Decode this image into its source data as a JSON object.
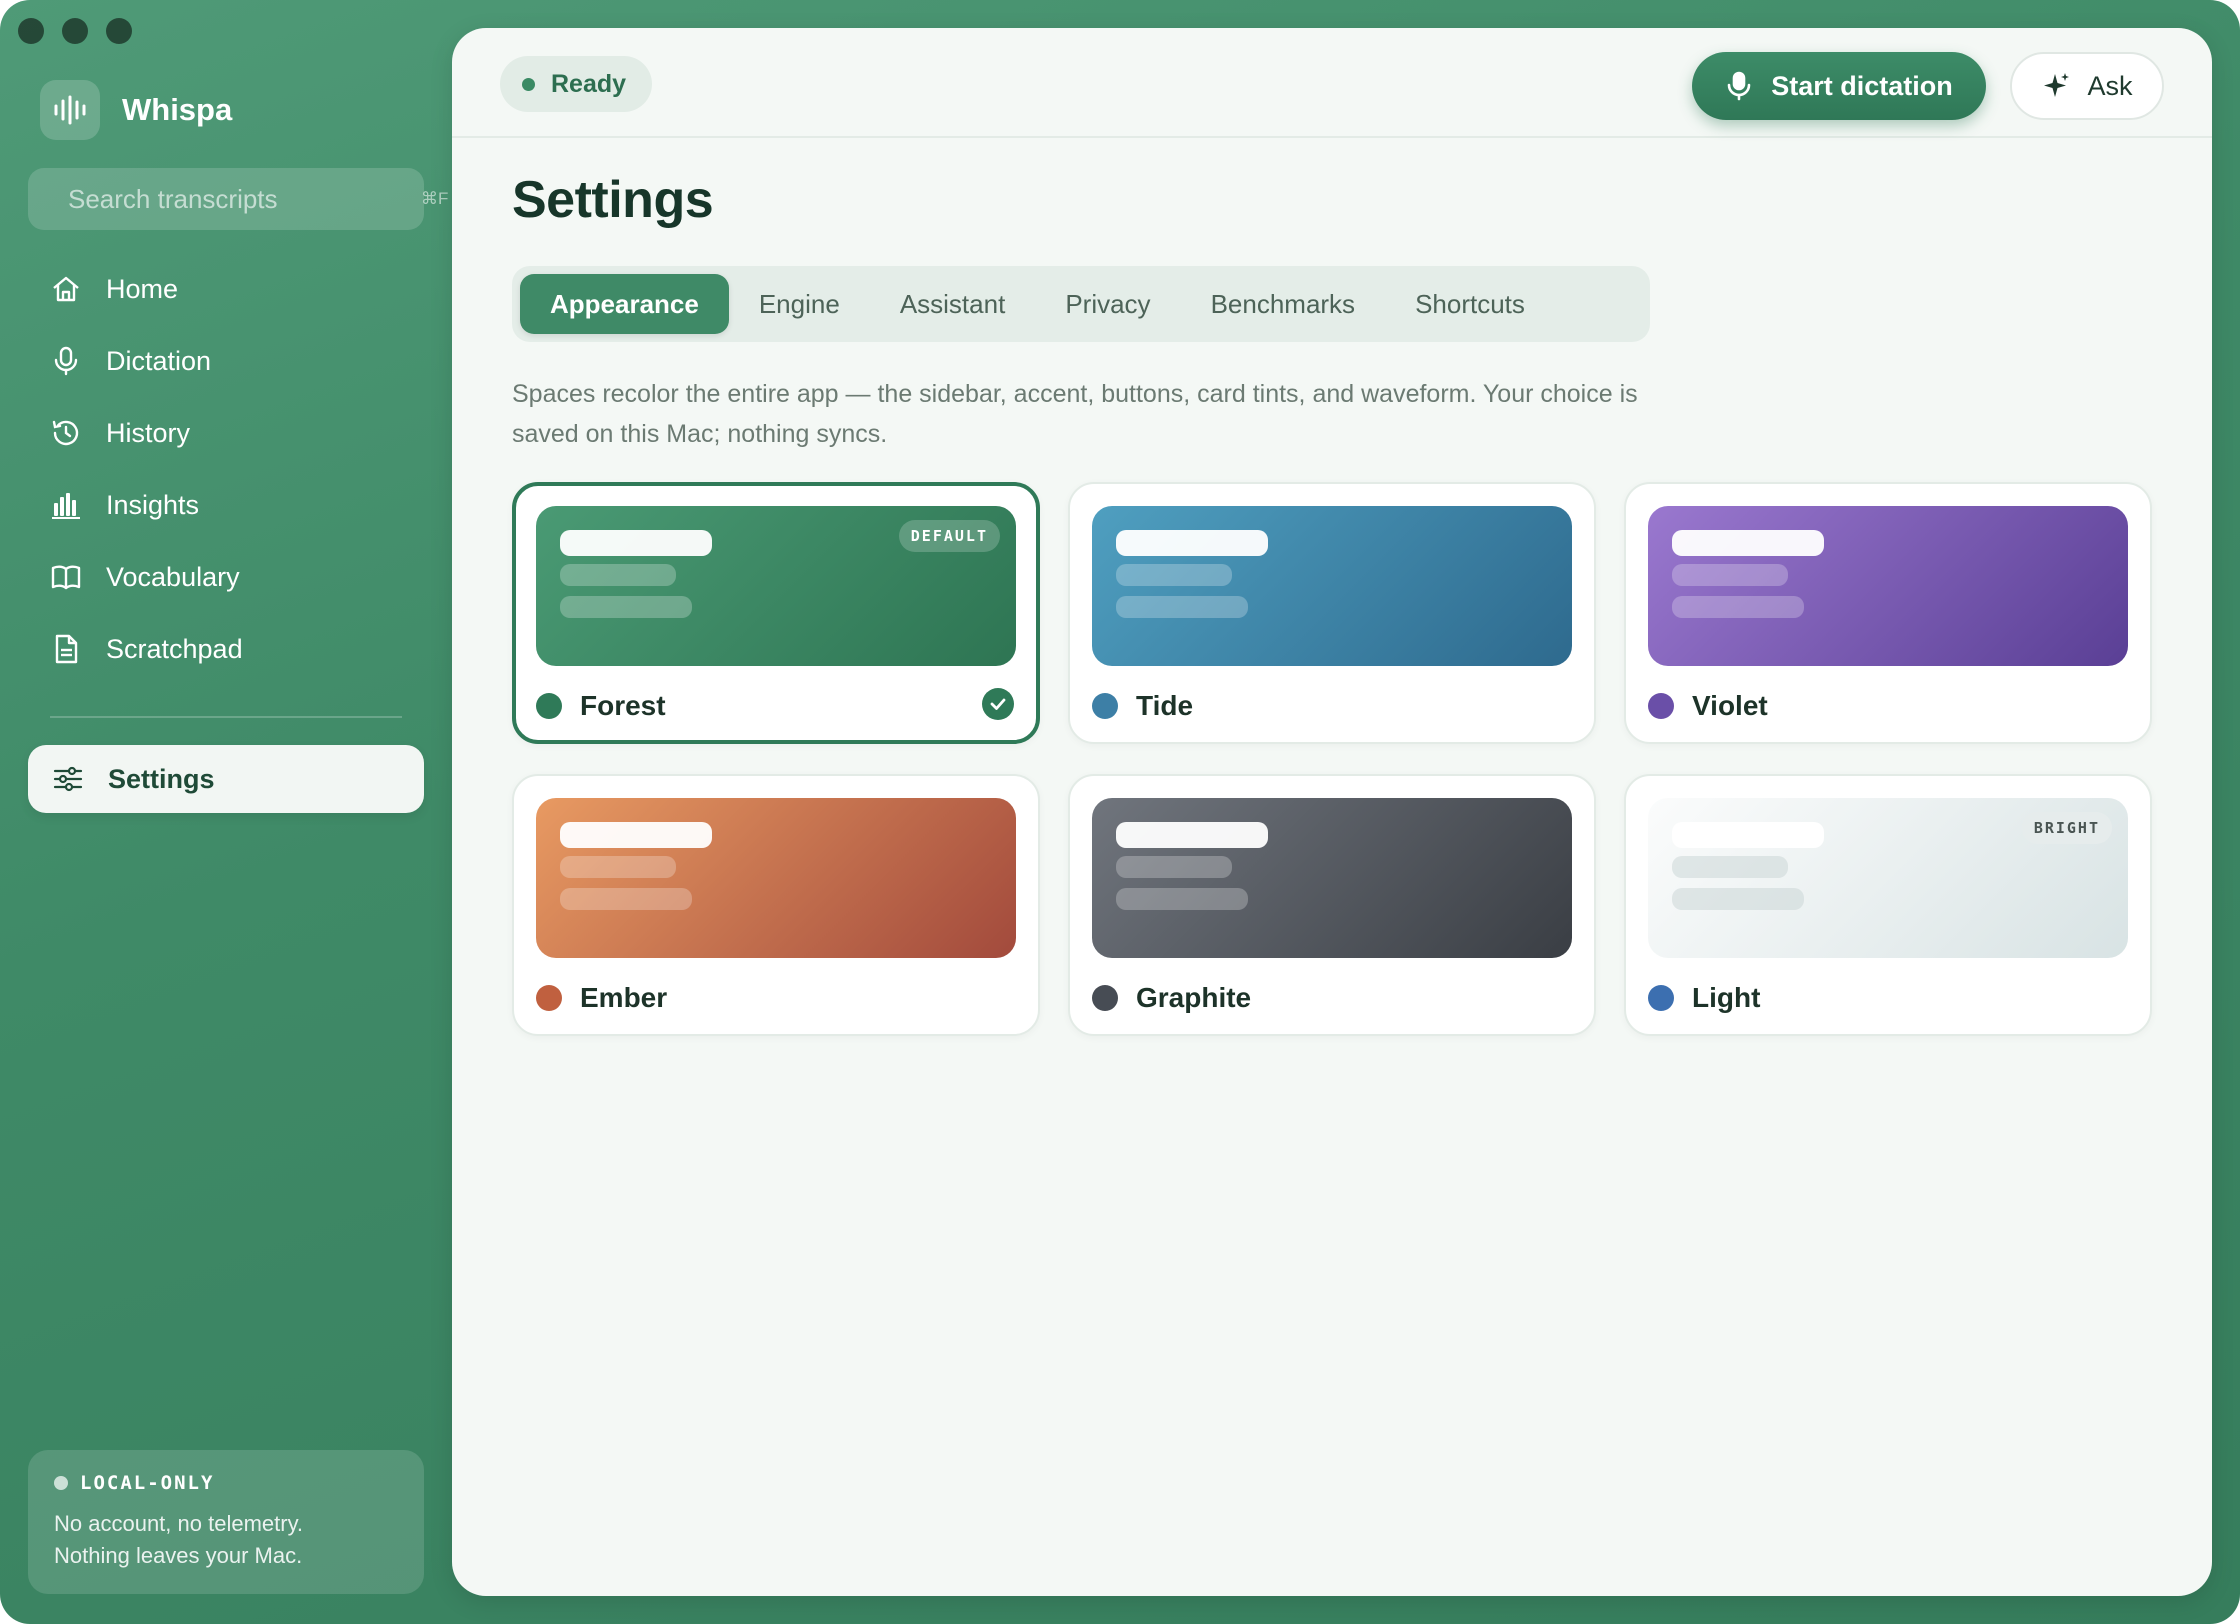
{
  "app": {
    "name": "Whispa"
  },
  "search": {
    "placeholder": "Search transcripts",
    "shortcut": "⌘F"
  },
  "nav": {
    "items": [
      {
        "label": "Home",
        "icon": "home-icon"
      },
      {
        "label": "Dictation",
        "icon": "microphone-icon"
      },
      {
        "label": "History",
        "icon": "history-icon"
      },
      {
        "label": "Insights",
        "icon": "bar-chart-icon"
      },
      {
        "label": "Vocabulary",
        "icon": "book-icon"
      },
      {
        "label": "Scratchpad",
        "icon": "document-icon"
      }
    ],
    "settings_label": "Settings"
  },
  "local": {
    "title": "LOCAL-ONLY",
    "line1": "No account, no telemetry.",
    "line2": "Nothing leaves your Mac."
  },
  "topbar": {
    "status": "Ready",
    "dictation_label": "Start dictation",
    "ask_label": "Ask"
  },
  "page": {
    "title": "Settings",
    "tabs": [
      "Appearance",
      "Engine",
      "Assistant",
      "Privacy",
      "Benchmarks",
      "Shortcuts"
    ],
    "active_tab": "Appearance",
    "description": "Spaces recolor the entire app — the sidebar, accent, buttons, card tints, and waveform. Your choice is saved on this Mac; nothing syncs."
  },
  "spaces": [
    {
      "name": "Forest",
      "badge": "DEFAULT",
      "selected": true,
      "swatch": "#2f7a58",
      "gradient": [
        "#4a9a74",
        "#2e7553"
      ],
      "light": false
    },
    {
      "name": "Tide",
      "badge": "",
      "selected": false,
      "swatch": "#3d7fa6",
      "gradient": [
        "#4f9fc0",
        "#2e6a8e"
      ],
      "light": false
    },
    {
      "name": "Violet",
      "badge": "",
      "selected": false,
      "swatch": "#6a4fa8",
      "gradient": [
        "#9a78cf",
        "#5a3f95"
      ],
      "light": false
    },
    {
      "name": "Ember",
      "badge": "",
      "selected": false,
      "swatch": "#c0603f",
      "gradient": [
        "#e89a62",
        "#a24a3c"
      ],
      "light": false
    },
    {
      "name": "Graphite",
      "badge": "",
      "selected": false,
      "swatch": "#474c54",
      "gradient": [
        "#70757d",
        "#3a3e44"
      ],
      "light": false
    },
    {
      "name": "Light",
      "badge": "BRIGHT",
      "selected": false,
      "swatch": "#3c6fb0",
      "gradient": [
        "#fbfcfc",
        "#d8e3e4"
      ],
      "light": true
    }
  ]
}
